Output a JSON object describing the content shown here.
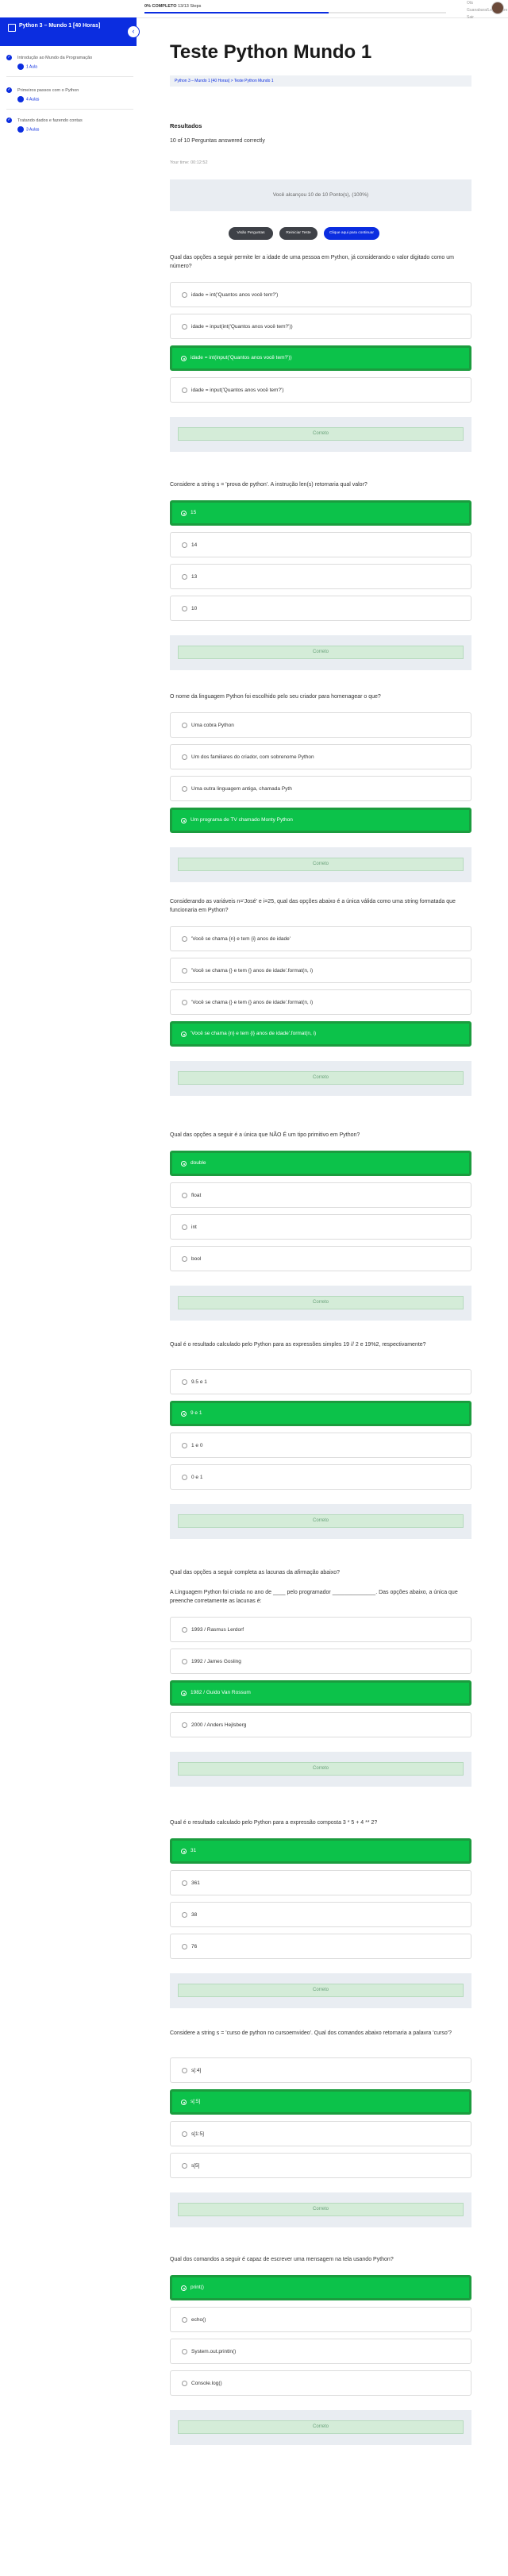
{
  "topbar": {
    "progress_label": "0% COMPLETO",
    "progress_detail": "13/13 Steps",
    "progress_value": 0.61,
    "user_line1": "Olá",
    "user_line2": "Guanabara/Legendaire",
    "user_line3": "Sair"
  },
  "sidebar": {
    "course_title": "Python 3 – Mundo 1 [40 Horas]",
    "toggle_icon": "‹",
    "lessons": [
      {
        "title": "Introdução ao Mundo da Programação",
        "meta": "1 Aula"
      },
      {
        "title": "Primeiros passos com o Python",
        "meta": "4 Aulas"
      },
      {
        "title": "Tratando dados e fazendo contas",
        "meta": "3 Aulas"
      }
    ]
  },
  "main": {
    "title": "Teste Python Mundo 1",
    "breadcrumb": "Python 3 – Mundo 1 [40 Horas] > Teste Python Mundo 1",
    "results_heading": "Resultados",
    "results_summary": "10 of 10 Perguntas answered correctly",
    "timer": "Your time: 00:12:52",
    "score": "Você alcançou 10 de 10 Ponto(s), (100%)",
    "buttons": {
      "view_questions": "Visão Perguntas",
      "restart": "Reiniciar Teste",
      "continue": "Clique aqui para continuar"
    }
  },
  "feedback_label": "Correto",
  "questions": [
    {
      "text": "Qual das opções a seguir permite ler a idade de uma pessoa em Python, já considerando o valor digitado como um número?",
      "options": [
        "idade = int('Quantos anos você tem?')",
        "idade = input(int('Quantos anos você tem?'))",
        "idade = int(input('Quantos anos você tem?'))",
        "idade = input('Quantos anos você tem?')"
      ],
      "correct": 2
    },
    {
      "text": "Considere a string s = 'prova de python'. A instrução len(s) retornaria qual valor?",
      "options": [
        "15",
        "14",
        "13",
        "10"
      ],
      "correct": 0
    },
    {
      "text": "O nome da linguagem Python foi escolhido pelo seu criador para homenagear o que?",
      "options": [
        "Uma cobra Python",
        "Um dos familiares do criador, com sobrenome Python",
        "Uma outra linguagem antiga, chamada Pyth",
        "Um programa de TV chamado Monty Python"
      ],
      "correct": 3
    },
    {
      "text": "Considerando as variáveis n='José' e i=25, qual das opções abaixo é a única válida como uma string formatada que funcionaria em Python?",
      "options": [
        "'Você se chama {n} e tem {i} anos de idade'",
        "'Você se chama {} e tem {} anos de idade'.format(n, i)",
        "'Você se chama {} e tem {} anos de idade'.format(n, i)",
        "'Você se chama {n} e tem {i} anos de idade'.format(n, i)"
      ],
      "correct": 3
    },
    {
      "text": "Qual das opções a seguir é a única que NÃO É um tipo primitivo em Python?",
      "options": [
        "double",
        "float",
        "int",
        "bool"
      ],
      "correct": 0
    },
    {
      "text": "Qual é o resultado calculado pelo Python para as expressões simples 19 // 2 e 19%2, respectivamente?",
      "options": [
        "9.5 e 1",
        "9 e 1",
        "1 e 0",
        "0 e 1"
      ],
      "correct": 1
    },
    {
      "text": "Qual das opções a seguir completa as lacunas da afirmação abaixo?",
      "text2": "A Linguagem Python foi criada no ano de ____ pelo programador ______________. Das opções abaixo, a única que preenche corretamente as lacunas é:",
      "options": [
        "1993 / Rasmus Lerdorf",
        "1992 / James Gosling",
        "1982 / Guido Van Rossum",
        "2000 / Anders Hejlsberg"
      ],
      "correct": 2
    },
    {
      "text": "Qual é o resultado calculado pelo Python para a expressão composta 3 * 5 + 4 ** 2?",
      "options": [
        "31",
        "361",
        "38",
        "76"
      ],
      "correct": 0
    },
    {
      "text": "Considere a string s = 'curso de python no cursoemvideo'. Qual dos comandos abaixo retornaria a palavra 'curso'?",
      "options": [
        "s[:4]",
        "s[:5]",
        "s[1:5]",
        "s[5]"
      ],
      "correct": 1
    },
    {
      "text": "Qual dos comandos a seguir é capaz de escrever uma mensagem na tela usando Python?",
      "options": [
        "print()",
        "echo()",
        "System.out.println()",
        "Console.log()"
      ],
      "correct": 0
    }
  ]
}
